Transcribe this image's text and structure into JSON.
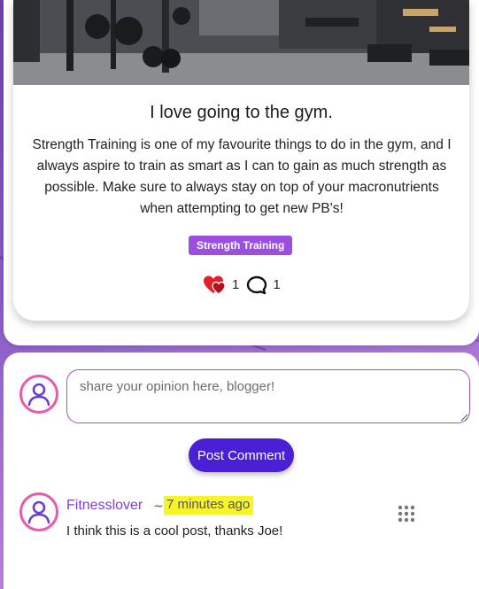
{
  "post": {
    "title": "I love going to the gym.",
    "body": "Strength Training is one of my favourite things to do in the gym, and I always aspire to train as smart as I can to gain as much strength as possible. Make sure to always stay on top of your macronutrients when attempting to get new PB's!",
    "tag": "Strength Training",
    "likes_count": "1",
    "comments_count": "1",
    "image_icon": "gym-photo"
  },
  "comment_form": {
    "placeholder": "share your opinion here, blogger!",
    "value": "",
    "submit_label": "Post Comment"
  },
  "comments": [
    {
      "author": "Fitnesslover",
      "separator": "~",
      "time": "7 minutes ago",
      "text": "I think this is a cool post, thanks Joe!"
    }
  ],
  "icons": {
    "like": "heart-icon",
    "comment": "speech-bubble-icon",
    "avatar": "user-avatar-icon",
    "drag": "drag-handle-icon"
  },
  "colors": {
    "accent": "#4a1fd6",
    "tag": "#9b4fe0",
    "author": "#7a3fe0",
    "highlight": "#f7f52a",
    "like": "#e0202a"
  }
}
